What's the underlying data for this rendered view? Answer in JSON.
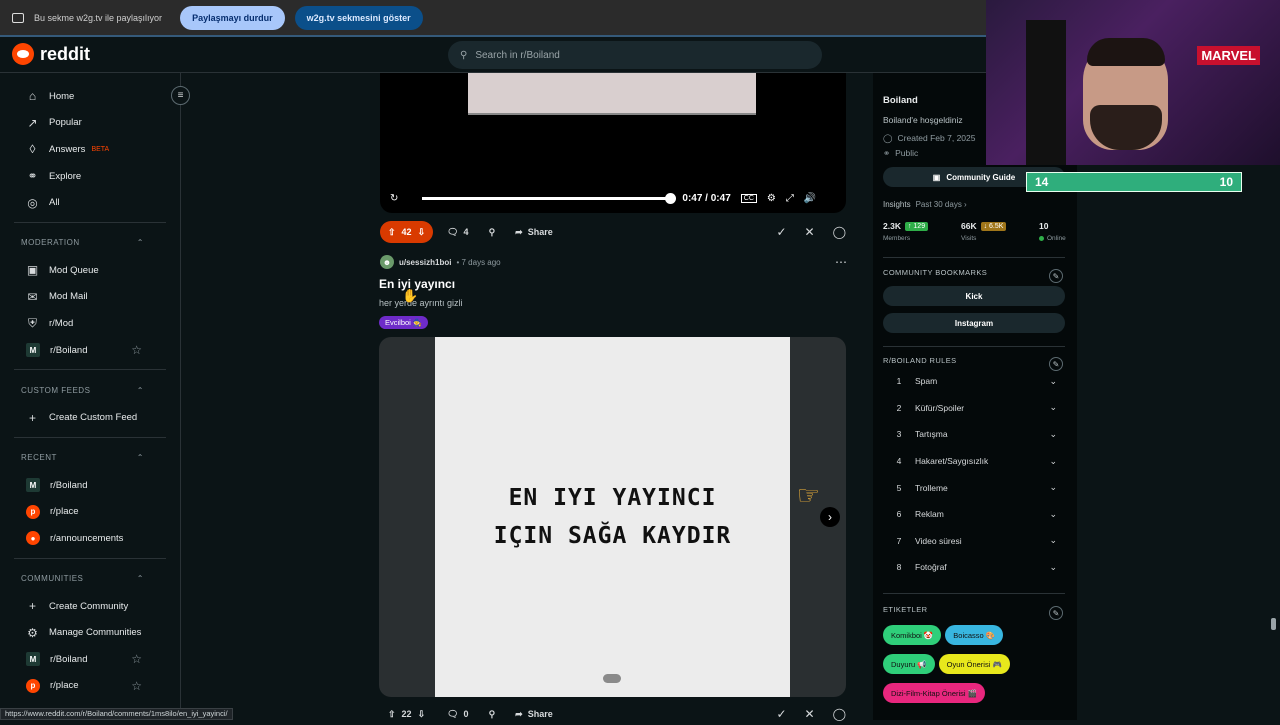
{
  "share_bar": {
    "message": "Bu sekme w2g.tv ile paylaşılıyor",
    "stop_label": "Paylaşmayı durdur",
    "show_label": "w2g.tv sekmesini göster"
  },
  "header": {
    "brand": "reddit",
    "search_placeholder": "Search in r/Boiland"
  },
  "sidebar": {
    "main": [
      {
        "label": "Home",
        "icon": "home-icon"
      },
      {
        "label": "Popular",
        "icon": "trending-icon"
      },
      {
        "label": "Answers",
        "icon": "answers-icon",
        "badge": "BETA"
      },
      {
        "label": "Explore",
        "icon": "explore-icon"
      },
      {
        "label": "All",
        "icon": "all-icon"
      }
    ],
    "moderation": {
      "title": "MODERATION",
      "items": [
        "Mod Queue",
        "Mod Mail",
        "r/Mod",
        "r/Boiland"
      ]
    },
    "custom_feeds": {
      "title": "CUSTOM FEEDS",
      "items": [
        "Create Custom Feed"
      ]
    },
    "recent": {
      "title": "RECENT",
      "items": [
        "r/Boiland",
        "r/place",
        "r/announcements"
      ]
    },
    "communities": {
      "title": "COMMUNITIES",
      "items": [
        "Create Community",
        "Manage Communities",
        "r/Boiland",
        "r/place"
      ]
    }
  },
  "video_post": {
    "time": "0:47 / 0:47",
    "progress": 1.0,
    "votes": "42",
    "comments": "4",
    "share_label": "Share"
  },
  "post": {
    "author": "u/sessizh1boi",
    "age": "• 7 days ago",
    "title": "En iyi yayıncı",
    "body": "her yerde ayrıntı gizli",
    "flair": "Evcilboi 🧙",
    "image_line1": "EN IYI YAYINCI",
    "image_line2": "IÇIN SAĞA KAYDIR",
    "votes": "22",
    "comments": "0",
    "share_label": "Share"
  },
  "right_panel": {
    "name": "Boiland",
    "welcome": "Boiland'e hoşgeldiniz",
    "created": "Created Feb 7, 2025",
    "visibility": "Public",
    "guide_button": "Community Guide",
    "insights_label": "Insights",
    "insights_period": "Past 30 days ›",
    "members_value": "2.3K",
    "members_delta": "↑ 129",
    "members_label": "Members",
    "visits_value": "66K",
    "visits_delta": "↓ 6.5K",
    "visits_label": "Visits",
    "online_value": "10",
    "online_label": "Online",
    "bookmarks_title": "COMMUNITY BOOKMARKS",
    "bookmarks": [
      "Kick",
      "Instagram"
    ],
    "rules_title": "R/BOILAND RULES",
    "rules": [
      "Spam",
      "Küfür/Spoiler",
      "Tartışma",
      "Hakaret/Saygısızlık",
      "Trolleme",
      "Reklam",
      "Video süresi",
      "Fotoğraf"
    ],
    "tags_title": "ETIKETLER",
    "tags": [
      {
        "label": "Komikboi 🤡",
        "color": "#2fcf7a"
      },
      {
        "label": "Boicasso 🎨",
        "color": "#38b6e0"
      },
      {
        "label": "Duyuru 📢",
        "color": "#2fcf7a"
      },
      {
        "label": "Oyun Önerisi 🎮",
        "color": "#e8e81c"
      },
      {
        "label": "Dizi-Film-Kitap Önerisi 🎬",
        "color": "#e8277e"
      }
    ]
  },
  "overlay": {
    "score_left": "14",
    "score_right": "10",
    "webcam_sign": "MARVEL"
  },
  "status_url": "https://www.reddit.com/r/Boiland/comments/1ms8ilo/en_iyi_yayinci/"
}
